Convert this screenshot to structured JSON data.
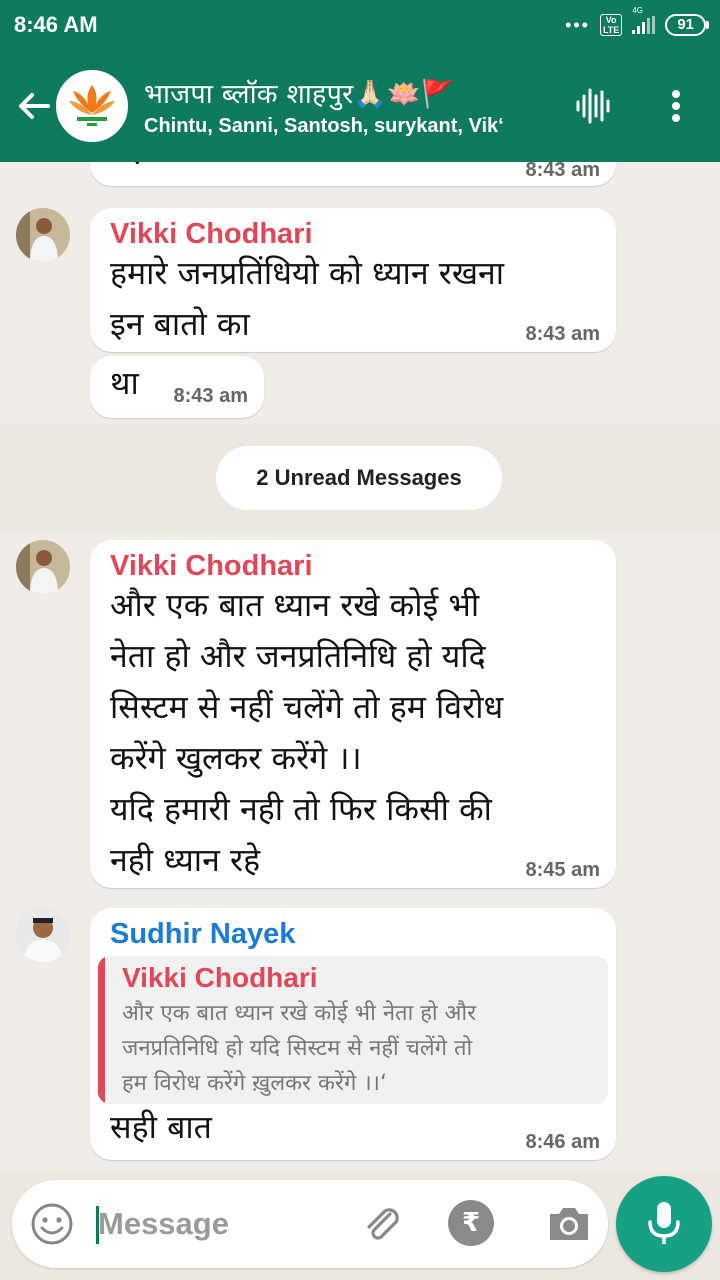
{
  "status_bar": {
    "time": "8:46 AM",
    "network": "4G",
    "volte": "Vo\nLTE",
    "battery": "91"
  },
  "header": {
    "title": "भाजपा ब्लॉक शाहपुर🙏🏻🪷🚩",
    "members": "Chintu, Sanni, Santosh, surykant, Vik‘"
  },
  "colors": {
    "primary": "#0e7a5d",
    "accent": "#16a084",
    "sender_red": "#e0485a",
    "sender_blue": "#1a7bd8"
  },
  "messages": [
    {
      "id": "m0",
      "text": "पढ़ा",
      "time": "8:43 am"
    },
    {
      "id": "m1",
      "sender": "Vikki Chodhari",
      "text": "हमारे जनप्रतिंधियो को ध्यान रखना\nइन बातो का",
      "time": "8:43 am"
    },
    {
      "id": "m2",
      "text": "था",
      "time": "8:43 am"
    },
    {
      "id": "m3",
      "sender": "Vikki Chodhari",
      "text": "और एक बात ध्यान रखे कोई भी\nनेता हो और जनप्रतिनिधि हो यदि\nसिस्टम से नहीं चलेंगे तो हम विरोध\nकरेंगे खुलकर करेंगे ।।\nयदि हमारी नही तो फिर किसी की\nनही ध्यान रहे",
      "time": "8:45 am"
    },
    {
      "id": "m4",
      "sender": "Sudhir Nayek",
      "quote": {
        "sender": "Vikki Chodhari",
        "text": "और एक बात ध्यान रखे कोई भी नेता हो और\nजनप्रतिनिधि हो यदि सिस्टम से नहीं चलेंगे तो\nहम विरोध करेंगे ख़ुलकर करेंगे ।।‘"
      },
      "text": "सही बात",
      "time": "8:46 am"
    }
  ],
  "unread_label": "2 Unread Messages",
  "composer": {
    "placeholder": "Message",
    "rupee_symbol": "₹"
  },
  "icons": [
    "back-arrow-icon",
    "voice-wave-icon",
    "more-vert-icon",
    "emoji-icon",
    "paperclip-icon",
    "rupee-icon",
    "camera-icon",
    "mic-icon"
  ]
}
